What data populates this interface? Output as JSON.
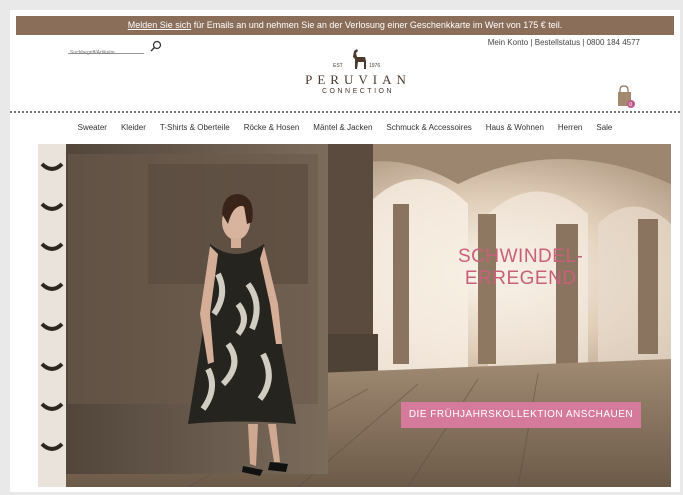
{
  "promo": {
    "link": "Melden Sie sich",
    "text": " für Emails an und nehmen Sie an der Verlosung einer Geschenkkarte im Wert von 175 € teil."
  },
  "search": {
    "placeholder": "Suchbegriff/Artikelnr."
  },
  "account": {
    "text": "Mein Konto | Bestellstatus | 0800 184 4577"
  },
  "logo": {
    "est": "EST",
    "year": "1976",
    "name": "PERUVIAN",
    "sub": "CONNECTION"
  },
  "nav": {
    "items": [
      "Sweater",
      "Kleider",
      "T-Shirts & Oberteile",
      "Röcke & Hosen",
      "Mäntel & Jacken",
      "Schmuck & Accessoires",
      "Haus & Wohnen",
      "Herren",
      "Sale"
    ]
  },
  "hero": {
    "title_line1": "SCHWINDEL-",
    "title_line2": "ERREGEND",
    "cta": "DIE FRÜHJAHRSKOLLEKTION ANSCHAUEN"
  },
  "colors": {
    "promo_bar": "#8b6e5a",
    "accent_pink": "#d57a9a",
    "title_pink": "#c8607a"
  }
}
